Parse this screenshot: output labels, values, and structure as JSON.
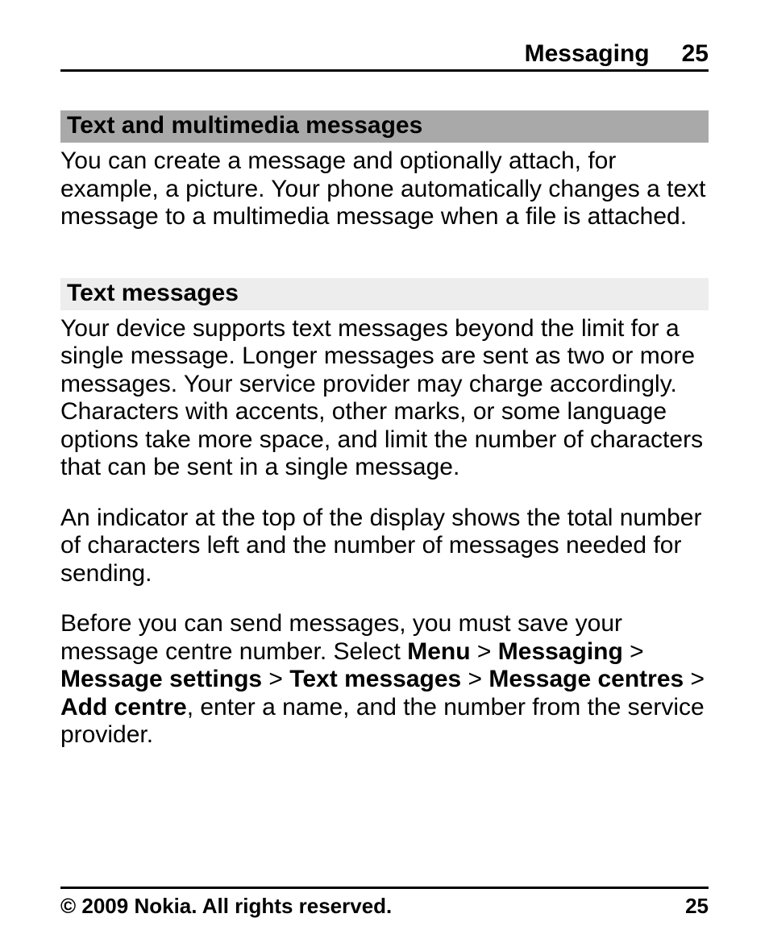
{
  "header": {
    "title": "Messaging",
    "page": "25"
  },
  "section1": {
    "title": "Text and multimedia messages",
    "para1": "You can create a message and optionally attach, for example, a picture. Your phone automatically changes a text message to a multimedia message when a file is attached."
  },
  "section2": {
    "title": "Text messages",
    "para1": "Your device supports text messages beyond the limit for a single message. Longer messages are sent as two or more messages. Your service provider may charge accordingly. Characters with accents, other marks, or some language options take more space, and limit the number of characters that can be sent in a single message.",
    "para2": "An indicator at the top of the display shows the total number of characters left and the number of messages needed for sending.",
    "para3_pre": "Before you can send messages, you must save your message centre number. Select ",
    "menu": "Menu",
    "gt1": " > ",
    "messaging": "Messaging",
    "gt2": " > ",
    "msg_settings": "Message settings",
    "gt3": " > ",
    "text_messages": "Text messages",
    "gt4": " > ",
    "msg_centres": "Message centres",
    "gt5": " > ",
    "add_centre": "Add centre",
    "para3_post": ", enter a name, and the number from the service provider."
  },
  "footer": {
    "copyright": "© 2009 Nokia. All rights reserved.",
    "page": "25"
  }
}
